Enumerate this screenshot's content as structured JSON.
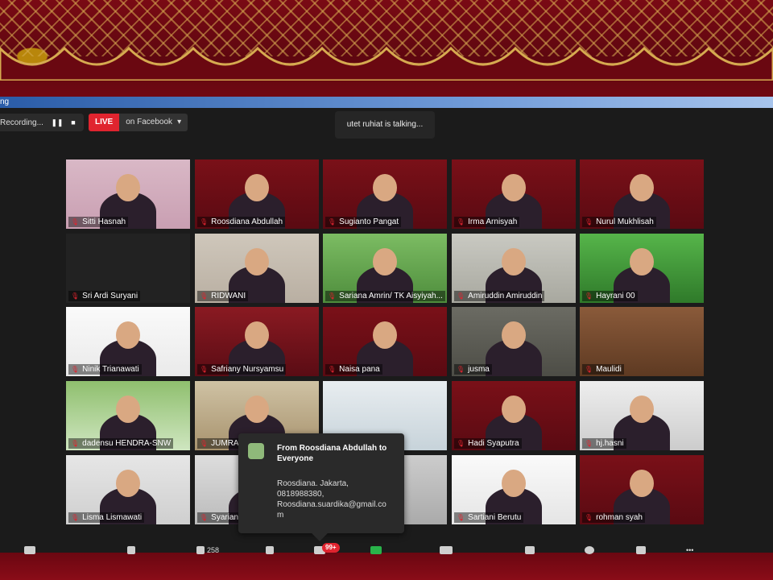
{
  "window": {
    "title_fragment": "ng"
  },
  "recording": {
    "label": "Recording...",
    "pause_icon": "pause-icon",
    "stop_icon": "stop-icon"
  },
  "live": {
    "badge": "LIVE",
    "platform": "on Facebook",
    "dropdown_icon": "caret-down-icon"
  },
  "talking": {
    "text": "utet ruhiat is talking..."
  },
  "participants": [
    {
      "name": "Sitti Hasnah"
    },
    {
      "name": "Roosdiana Abdullah"
    },
    {
      "name": "Sugianto Pangat"
    },
    {
      "name": "Irma Arnisyah"
    },
    {
      "name": "Nurul Mukhlisah"
    },
    {
      "name": "Sri Ardi Suryani"
    },
    {
      "name": "RIDWANI"
    },
    {
      "name": "Sariana Amrin/ TK Aisyiyah..."
    },
    {
      "name": "Amiruddin Amiruddin"
    },
    {
      "name": "Hayrani 00"
    },
    {
      "name": "Ninik Trianawati"
    },
    {
      "name": "Safriany Nursyamsu"
    },
    {
      "name": "Naisa pana"
    },
    {
      "name": "jusma"
    },
    {
      "name": "Maulidi"
    },
    {
      "name": "dadensu HENDRA-SNW"
    },
    {
      "name": "JUMRAENI"
    },
    {
      "name": "i"
    },
    {
      "name": "Hadi Syaputra"
    },
    {
      "name": "hj.hasni"
    },
    {
      "name": "Lisma Lismawati"
    },
    {
      "name": "Syariana"
    },
    {
      "name": ""
    },
    {
      "name": "Sartiani Berutu"
    },
    {
      "name": "rohman syah"
    }
  ],
  "chat": {
    "from": "From Roosdiana Abdullah to Everyone",
    "message": "Roosdiana. Jakarta,\n0818988380,\nRoosdiana.suardika@gmail.co\nm"
  },
  "toolbar": {
    "participants_count": "258",
    "chat_badge": "99+"
  },
  "colors": {
    "accent_red": "#e0242f",
    "banner_maroon": "#7a0a14",
    "gold": "#d6aa50"
  }
}
